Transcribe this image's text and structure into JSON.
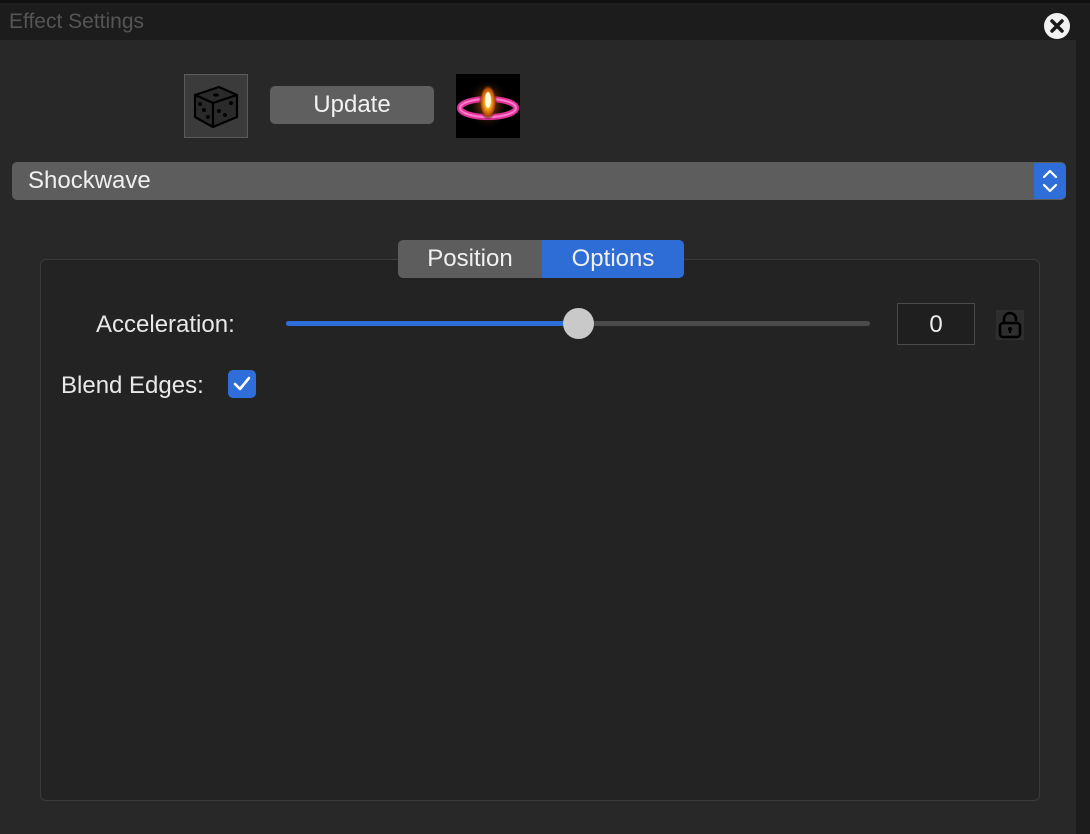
{
  "window": {
    "title": "Effect Settings"
  },
  "toolbar": {
    "randomize_icon": "dice-icon",
    "update_label": "Update",
    "preview_icon": "shockwave-preview-icon"
  },
  "effect_select": {
    "selected": "Shockwave"
  },
  "tabs": [
    {
      "label": "Position",
      "selected": false
    },
    {
      "label": "Options",
      "selected": true
    }
  ],
  "options": {
    "acceleration": {
      "label": "Acceleration:",
      "value": "0",
      "slider_fraction": 0.5,
      "locked": false
    },
    "blend_edges": {
      "label": "Blend Edges:",
      "checked": true
    }
  },
  "colors": {
    "accent": "#2f6ed8",
    "panel_bg": "#282828",
    "control_bg": "#5d5d5d"
  }
}
